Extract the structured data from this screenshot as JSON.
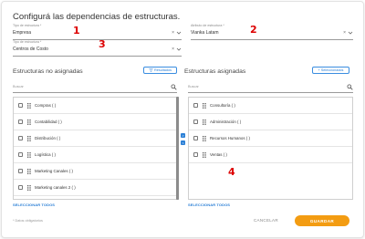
{
  "dialog": {
    "title": "Configurá las dependencias de estructuras."
  },
  "fields": {
    "tipo_estructura_1": {
      "label": "Tipo de estructura *",
      "value": "Empresa"
    },
    "atributo_estructura": {
      "label": "Atributo de estructura *",
      "value": "Vianka Latam"
    },
    "tipo_estructura_2": {
      "label": "Tipo de estructura *",
      "value": "Centros de Costo"
    }
  },
  "annotations": [
    "1",
    "2",
    "3",
    "4"
  ],
  "left_panel": {
    "title": "Estructuras no asignadas",
    "results_button": "Resultados",
    "search_placeholder": "Buscar",
    "items": [
      "Compras ( )",
      "Contabilidad ( )",
      "Distribución ( )",
      "Logística ( )",
      "Marketing Canales ( )",
      "Marketing canales 2 ( )"
    ],
    "select_all": "SELECCIONAR TODOS"
  },
  "right_panel": {
    "title": "Estructuras asignadas",
    "selected_button": "Seleccionados",
    "search_placeholder": "Buscar",
    "items": [
      "Consultoría ( )",
      "Administración ( )",
      "Recursos Humanos ( )",
      "Ventas ( )"
    ],
    "select_all": "SELECCIONAR TODOS"
  },
  "move_buttons": {
    "right": ">",
    "left": "<"
  },
  "footer": {
    "note": "* Datos obligatorios",
    "cancel": "CANCELAR",
    "save": "GUARDAR"
  },
  "icons": [
    "chevron-down-icon",
    "close-icon",
    "search-icon",
    "drag-handle-icon",
    "filter-icon",
    "plus-icon"
  ],
  "colors": {
    "accent": "#2a7fd6",
    "save": "#f39c12",
    "annotation": "#dd0000"
  }
}
